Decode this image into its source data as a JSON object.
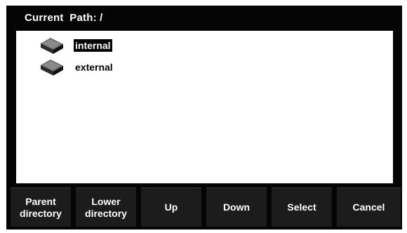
{
  "header": {
    "title": "Current  Path: /"
  },
  "file_list": {
    "items": [
      {
        "label": "internal",
        "selected": true,
        "icon": "drive-icon"
      },
      {
        "label": "external",
        "selected": false,
        "icon": "drive-icon"
      }
    ]
  },
  "softkeys": [
    {
      "label": "Parent\ndirectory"
    },
    {
      "label": "Lower\ndirectory"
    },
    {
      "label": "Up"
    },
    {
      "label": "Down"
    },
    {
      "label": "Select"
    },
    {
      "label": "Cancel"
    }
  ],
  "colors": {
    "background": "#050505",
    "panel": "#ffffff",
    "button": "#1c1c1c",
    "text_light": "#ffffff",
    "selection": "#000000"
  }
}
